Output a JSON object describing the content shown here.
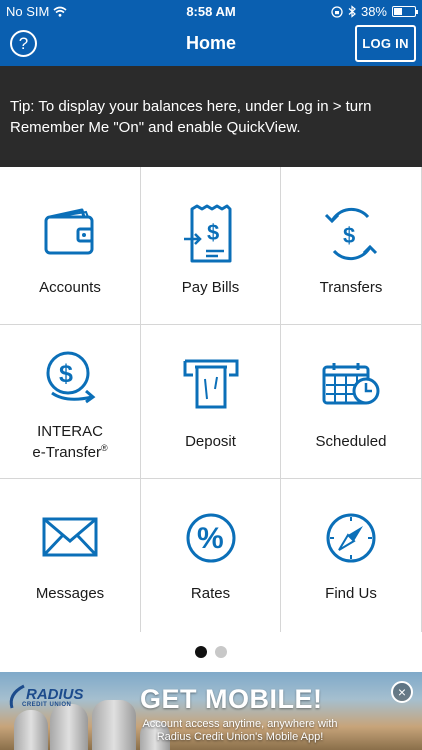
{
  "status_bar": {
    "carrier": "No SIM",
    "time": "8:58 AM",
    "battery": "38%",
    "battery_level": 0.38
  },
  "nav": {
    "title": "Home",
    "help_label": "?",
    "login_label": "LOG IN"
  },
  "tip": {
    "text": "Tip: To display your balances here, under Log in > turn Remember Me \"On\" and enable QuickView."
  },
  "menu": [
    {
      "label": "Accounts",
      "icon": "wallet-icon"
    },
    {
      "label": "Pay Bills",
      "icon": "bill-icon"
    },
    {
      "label": "Transfers",
      "icon": "transfer-icon"
    },
    {
      "label_line1": "INTERAC",
      "label_line2": "e-Transfer",
      "label_sup": "®",
      "icon": "etransfer-icon"
    },
    {
      "label": "Deposit",
      "icon": "atm-deposit-icon"
    },
    {
      "label": "Scheduled",
      "icon": "calendar-clock-icon"
    },
    {
      "label": "Messages",
      "icon": "envelope-icon"
    },
    {
      "label": "Rates",
      "icon": "percent-icon"
    },
    {
      "label": "Find Us",
      "icon": "compass-icon"
    }
  ],
  "pagination": {
    "pages": 2,
    "current": 1
  },
  "ad": {
    "brand": "RADIUS",
    "brand_sub": "CREDIT UNION",
    "headline": "GET MOBILE!",
    "line1": "Account access anytime, anywhere with",
    "line2": "Radius Credit Union's Mobile App!",
    "close_label": "×"
  },
  "colors": {
    "brand_blue": "#0a5fb0",
    "icon_blue": "#0b6fb8",
    "tip_background": "#2b2b2b"
  }
}
